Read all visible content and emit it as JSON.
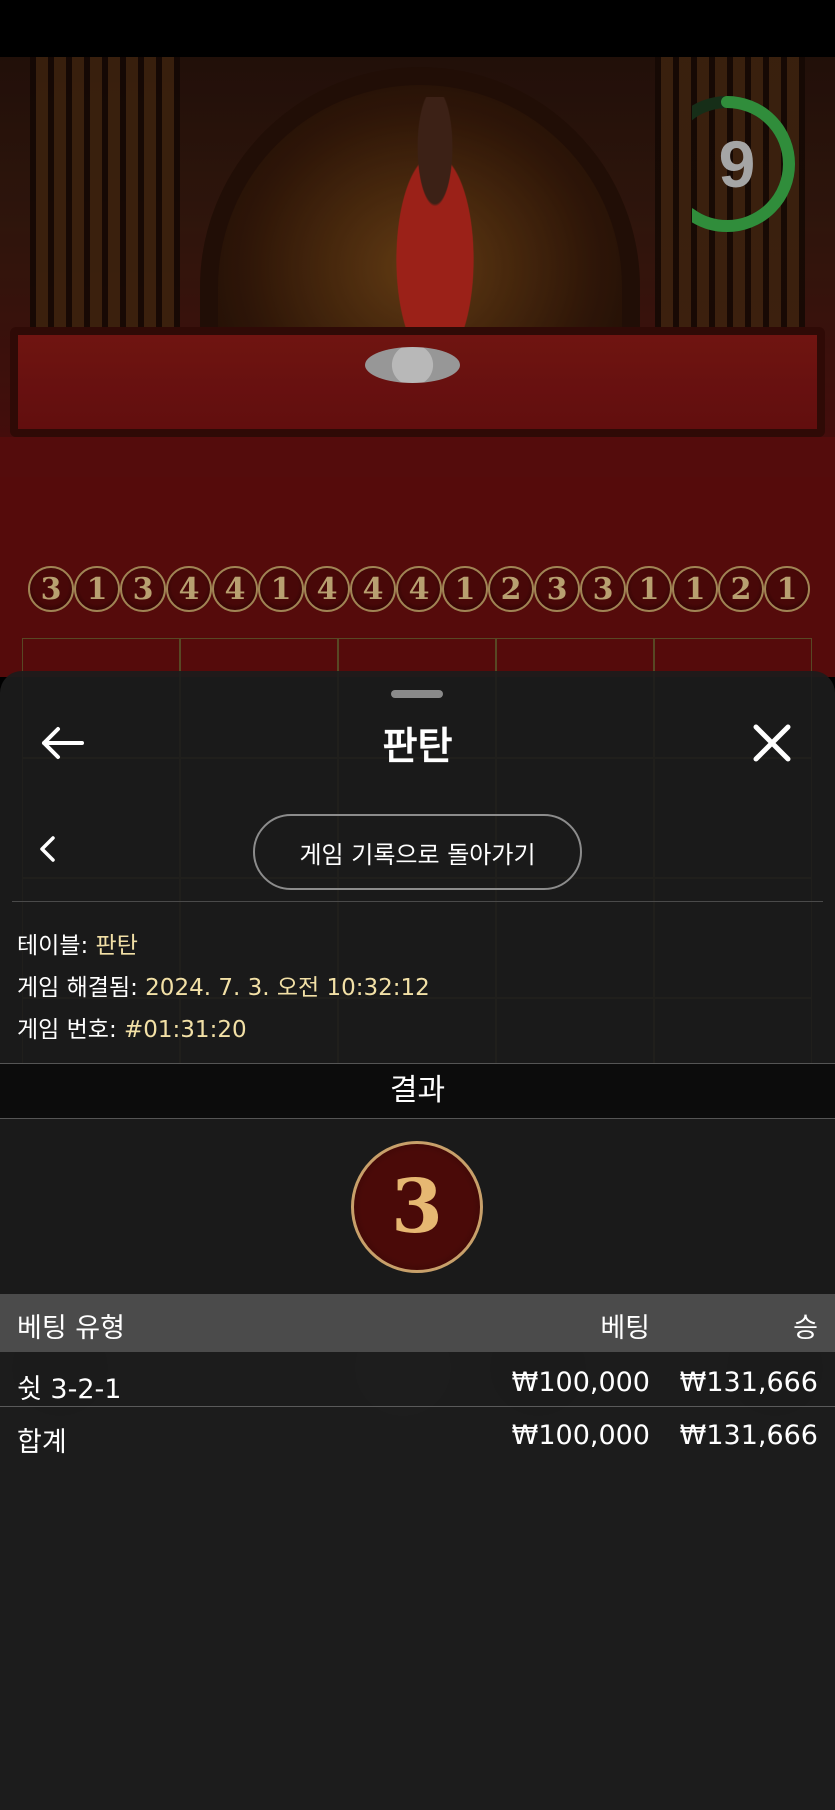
{
  "game_background": {
    "timer_value": "9",
    "timer_progress": 0.6,
    "history_results": [
      "3",
      "1",
      "3",
      "4",
      "4",
      "1",
      "4",
      "4",
      "4",
      "1",
      "2",
      "3",
      "3",
      "1",
      "1",
      "2",
      "1"
    ],
    "bet_cells": [
      "",
      "",
      "",
      "",
      "",
      "",
      "",
      "",
      "",
      "",
      "",
      "",
      "",
      "",
      "",
      "",
      "",
      "",
      "",
      ""
    ]
  },
  "sheet": {
    "title": "판탄",
    "back_to_history_label": "게임 기록으로 돌아가기",
    "info": {
      "table_label": "테이블: ",
      "table_value": "판탄",
      "resolved_label": "게임 해결됨: ",
      "resolved_value": "2024. 7. 3. 오전 10:32:12",
      "game_no_label": "게임 번호: ",
      "game_no_value": "#01:31:20"
    },
    "result_header": "결과",
    "result_value": "3",
    "table": {
      "headers": {
        "bet_type": "베팅 유형",
        "bet": "베팅",
        "win": "승"
      },
      "rows": [
        {
          "bet_type": "쉿 3-2-1",
          "bet": "₩100,000",
          "win": "₩131,666"
        }
      ],
      "total": {
        "label": "합계",
        "bet": "₩100,000",
        "win": "₩131,666"
      }
    }
  },
  "colors": {
    "sheet_bg": "#1c1c1c",
    "accent_gold": "#c8a06a",
    "info_value": "#f2e0a6",
    "table_header_bg": "#4b4b4b",
    "timer_green": "#3cb14a"
  }
}
